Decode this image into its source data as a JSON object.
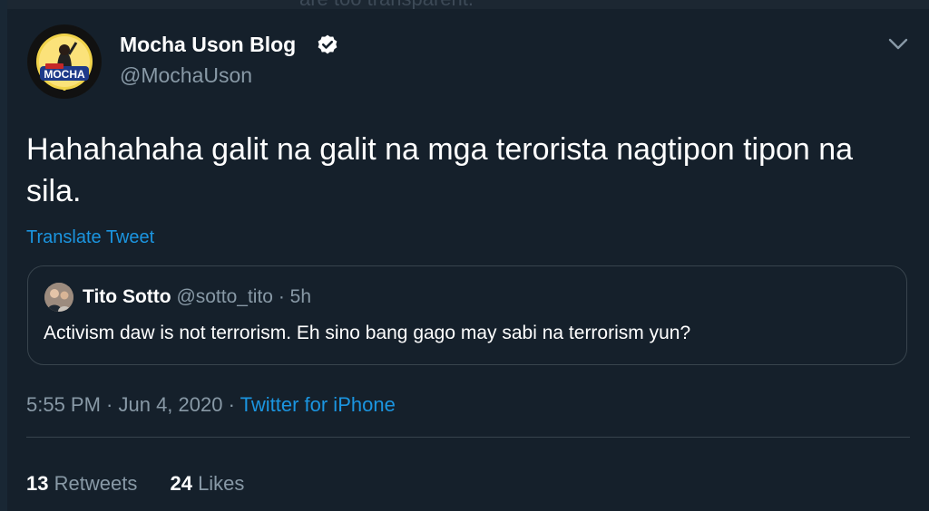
{
  "background_hint": {
    "partial_text": "are too transparent."
  },
  "author": {
    "display_name": "Mocha Uson Blog",
    "handle": "@MochaUson",
    "avatar_icon": "avatar-mocha-icon",
    "avatar_logo_text": "MOCHA",
    "verified": true
  },
  "tweet": {
    "text": "Hahahahaha galit na galit na mga terorista nagtipon tipon na sila.",
    "translate_label": "Translate Tweet"
  },
  "quoted_tweet": {
    "display_name": "Tito Sotto",
    "handle": "@sotto_tito",
    "time": "· 5h",
    "text": "Activism daw is not terrorism. Eh sino bang gago may sabi na terrorism yun?"
  },
  "meta": {
    "time_date": "5:55 PM · Jun 4, 2020 · ",
    "source": "Twitter for iPhone"
  },
  "stats": {
    "retweets_count": "13",
    "retweets_label": "Retweets",
    "likes_count": "24",
    "likes_label": "Likes"
  },
  "colors": {
    "background": "#15202b",
    "text_primary": "#ffffff",
    "text_secondary": "#8899a6",
    "link": "#1b95e0",
    "border": "#38444d"
  }
}
